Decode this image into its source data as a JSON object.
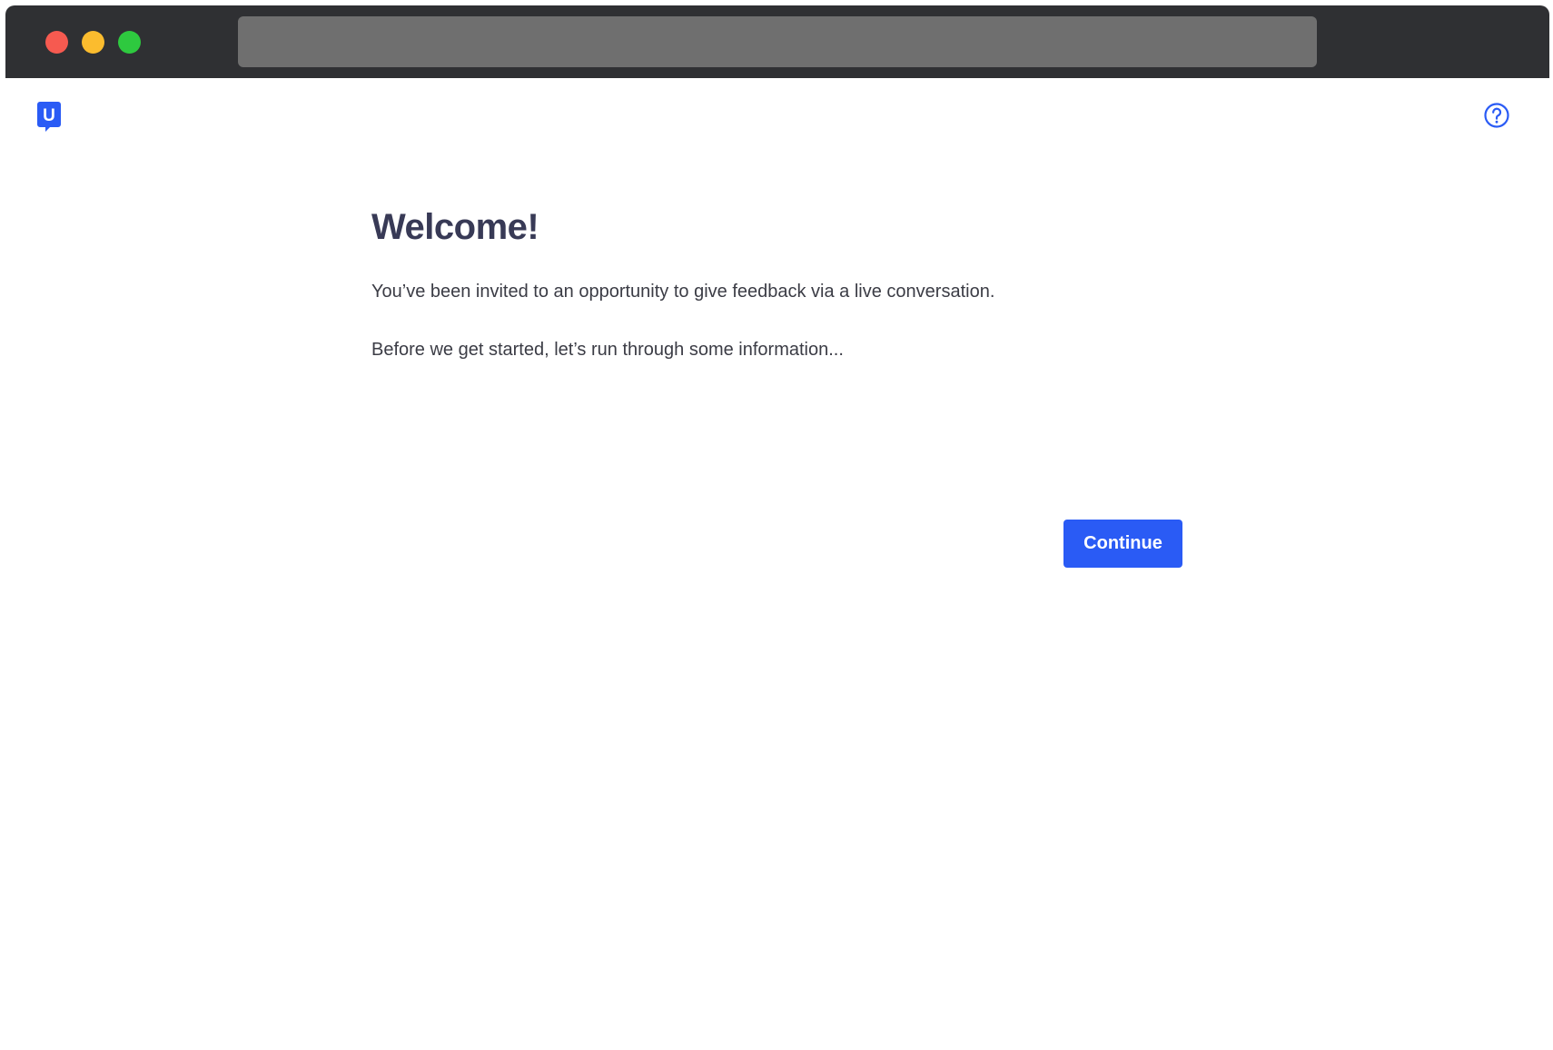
{
  "browser": {
    "address_bar_value": ""
  },
  "header": {
    "logo_letter": "U",
    "logo_icon": "usertesting-logo-icon",
    "help_icon": "help-circle-icon"
  },
  "main": {
    "title": "Welcome!",
    "paragraph_1": "You’ve been invited to an opportunity to give feedback via a live conversation.",
    "paragraph_2": "Before we get started, let’s run through some information...",
    "continue_label": "Continue"
  },
  "colors": {
    "accent": "#2a5bf5",
    "title": "#383a56",
    "body_text": "#3b3c45",
    "titlebar": "#2f3033"
  }
}
